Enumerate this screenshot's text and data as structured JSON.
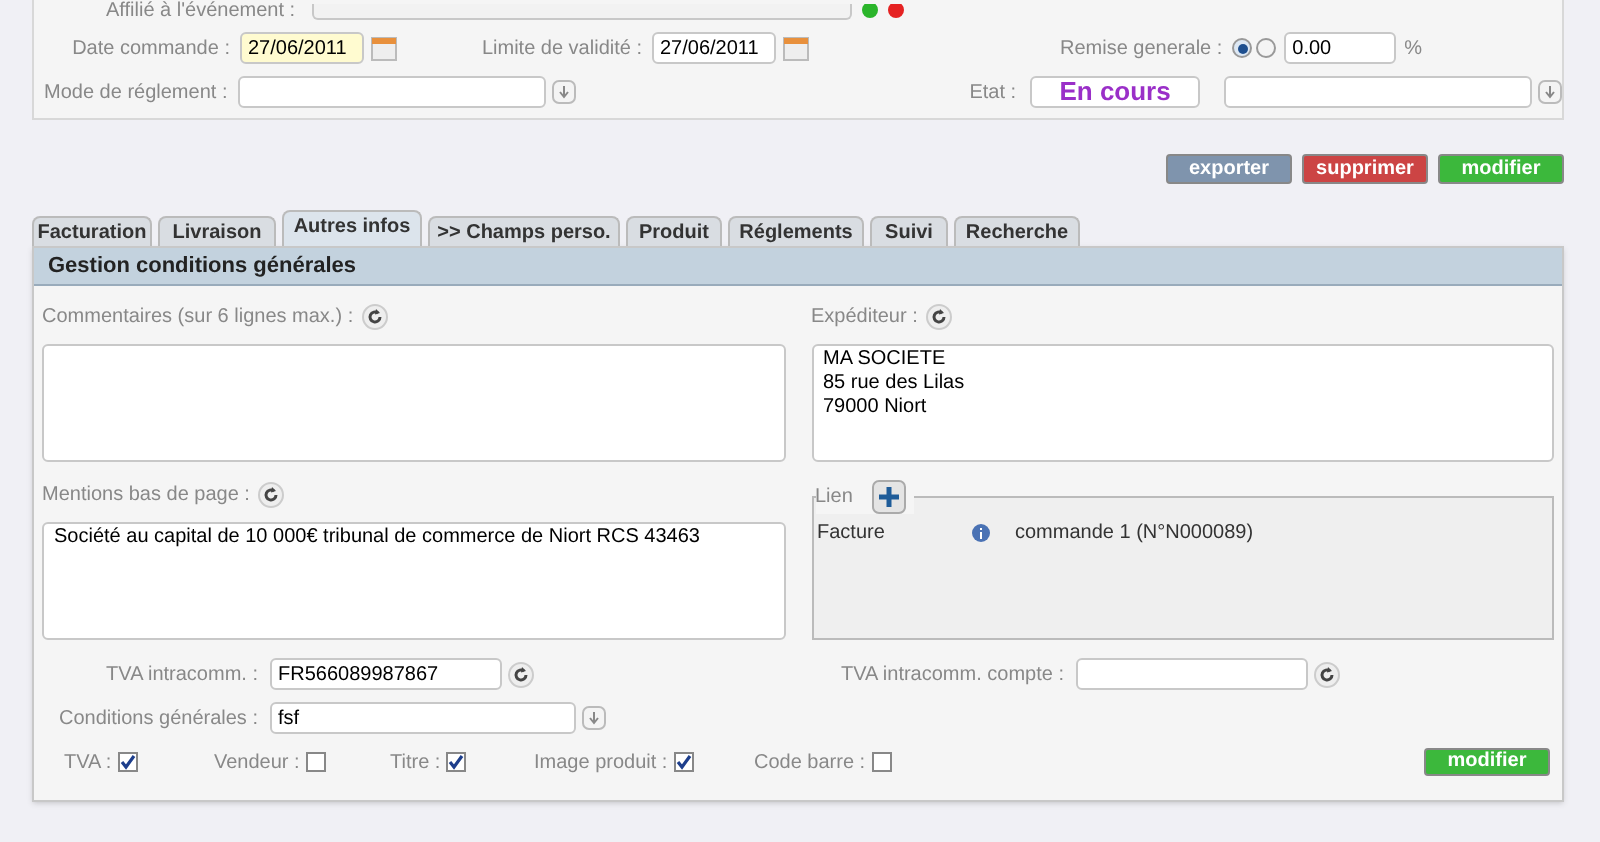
{
  "header_form": {
    "affiliate": {
      "label": "Affilié à l'événement :"
    },
    "date_commande": {
      "label": "Date commande :",
      "value": "27/06/2011"
    },
    "limite_validite": {
      "label": "Limite de validité :",
      "value": "27/06/2011"
    },
    "remise": {
      "label": "Remise generale :",
      "radios": [
        {
          "selected": true
        },
        {
          "selected": false
        }
      ],
      "value": "0.00",
      "unit": "%"
    },
    "mode_reglement": {
      "label": "Mode de réglement :"
    },
    "etat": {
      "label": "Etat :",
      "value": "En cours"
    }
  },
  "actions": [
    {
      "label": "exporter",
      "kind": "export"
    },
    {
      "label": "supprimer",
      "kind": "delete"
    },
    {
      "label": "modifier",
      "kind": "modify"
    }
  ],
  "tabs": [
    {
      "label": "Facturation",
      "selected": false
    },
    {
      "label": "Livraison",
      "selected": false
    },
    {
      "label": "Autres infos",
      "selected": true
    },
    {
      "label": ">> Champs perso.",
      "selected": false
    },
    {
      "label": "Produit",
      "selected": false
    },
    {
      "label": "Réglements",
      "selected": false
    },
    {
      "label": "Suivi",
      "selected": false
    },
    {
      "label": "Recherche",
      "selected": false
    }
  ],
  "section": {
    "title": "Gestion conditions générales",
    "commentaires": {
      "label": "Commentaires (sur 6 lignes max.) :"
    },
    "expediteur": {
      "label": "Expéditeur :",
      "value": "MA SOCIETE\n85 rue des Lilas\n79000 Niort"
    },
    "mentions": {
      "label": "Mentions bas de page :",
      "value": "Société au capital de 10 000€ tribunal de commerce de Niort RCS 43463"
    },
    "lien": {
      "label": "Lien",
      "entries": [
        {
          "type": "Facture",
          "text": "commande 1 (N°N000089)"
        }
      ]
    },
    "tva_intracomm": {
      "label": "TVA intracomm. :",
      "value": "FR566089987867"
    },
    "tva_compte": {
      "label": "TVA intracomm. compte :"
    },
    "conditions": {
      "label": "Conditions générales :",
      "value": "fsf"
    },
    "checkboxes": [
      {
        "label": "TVA :",
        "checked": true
      },
      {
        "label": "Vendeur :",
        "checked": false
      },
      {
        "label": "Titre :",
        "checked": true
      },
      {
        "label": "Image produit :",
        "checked": true
      },
      {
        "label": "Code barre :",
        "checked": false
      }
    ],
    "submit": "modifier"
  }
}
